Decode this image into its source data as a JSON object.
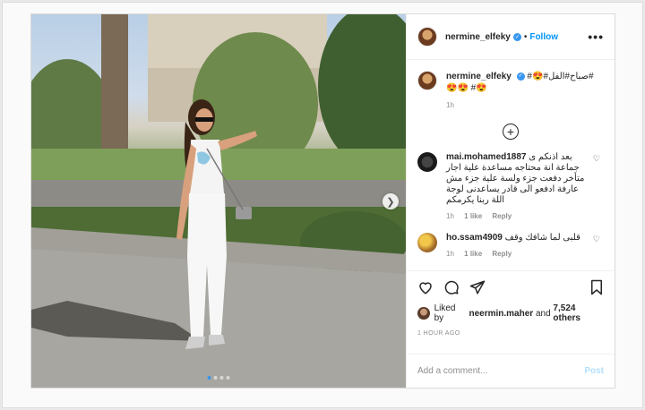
{
  "header": {
    "username": "nermine_elfeky",
    "separator": "•",
    "follow_label": "Follow",
    "more_icon": "more-options-icon"
  },
  "caption": {
    "username": "nermine_elfeky",
    "text": "#😍#صباح#الفل#😍😍 #😍",
    "time": "1h"
  },
  "comments": [
    {
      "username": "mai.mohamed1887",
      "text": "بعد اذنكم ى جماعة انة محتاجه مساعدة علية اجار متأخر دفعت جزء ولسة علية جزء مش عارفة ادفعو الى قادر يساعدنى لوجة اللة ربنا يكرمكم",
      "time": "1h",
      "likes": "1 like",
      "reply": "Reply"
    },
    {
      "username": "ho.ssam4909",
      "text": "قلبى لما شافك وقف",
      "time": "1h",
      "likes": "1 like",
      "reply": "Reply"
    }
  ],
  "likes": {
    "prefix": "Liked by",
    "user": "neermin.maher",
    "and": "and",
    "others": "7,524 others"
  },
  "timestamp": "1 HOUR AGO",
  "add_comment": {
    "placeholder": "Add a comment...",
    "post_label": "Post"
  },
  "carousel": {
    "slides": 4,
    "active_index": 0
  },
  "colors": {
    "accent": "#0095f6",
    "verified": "#3897f0",
    "post_disabled": "#b2dffc"
  }
}
